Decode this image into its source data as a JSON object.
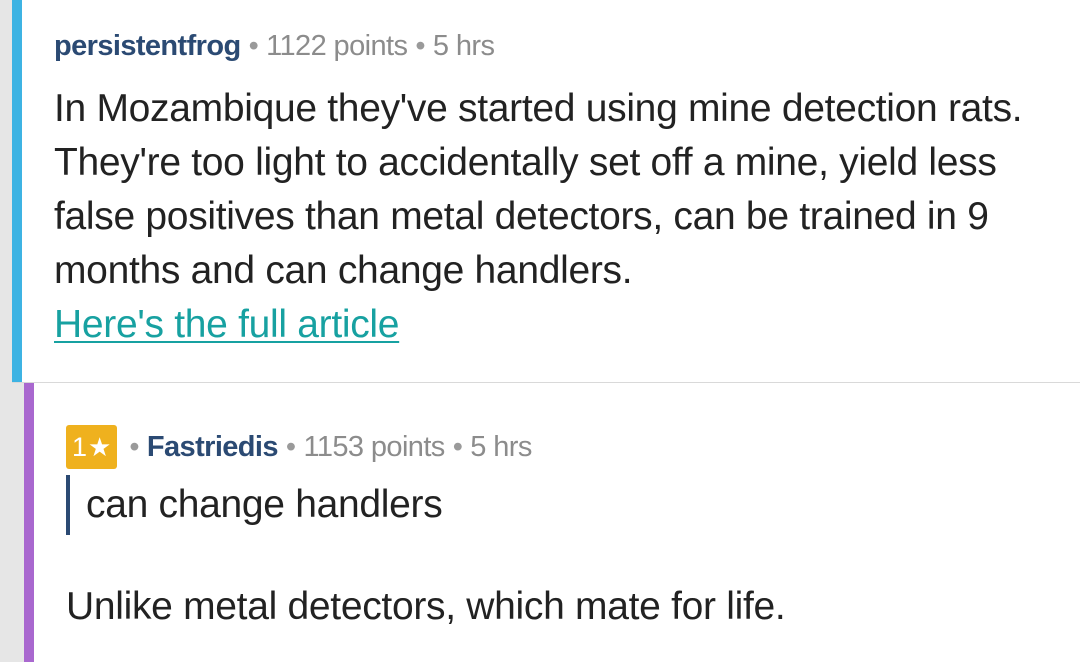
{
  "colors": {
    "depth_bar_1": "#3db3e3",
    "depth_bar_2": "#a968cf",
    "author": "#2b4a73",
    "link": "#17a1a1",
    "badge": "#efb11e",
    "meta": "#8c8c8c"
  },
  "comment_1": {
    "author": "persistentfrog",
    "separator": "•",
    "points": "1122 points",
    "time": "5 hrs",
    "body": "In Mozambique they've started using mine detection rats. They're too light to accidentally set off a mine, yield less false positives than metal detectors, can be trained in 9 months and can change handlers.",
    "link_text": "Here's the full article"
  },
  "comment_2": {
    "badge_count": "1",
    "badge_icon": "star-icon",
    "badge_glyph": "★",
    "separator": "•",
    "author": "Fastriedis",
    "points": "1153 points",
    "time": "5 hrs",
    "quote": "can change handlers",
    "body": "Unlike metal detectors, which mate for life."
  }
}
